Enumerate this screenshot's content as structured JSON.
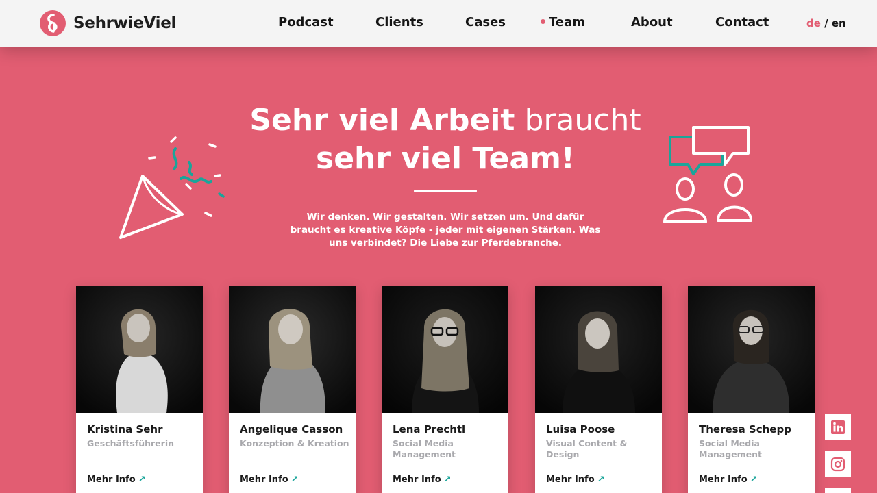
{
  "brand": {
    "name": "SehrwieViel",
    "accent": "#e25d72",
    "teal": "#1aa59a"
  },
  "nav": {
    "items": [
      {
        "label": "Podcast"
      },
      {
        "label": "Clients"
      },
      {
        "label": "Cases"
      },
      {
        "label": "Team",
        "active": true
      },
      {
        "label": "About"
      },
      {
        "label": "Contact"
      }
    ]
  },
  "lang": {
    "current": "de",
    "separator": " / ",
    "other": "en"
  },
  "hero": {
    "title_bold_1": "Sehr viel Arbeit",
    "title_light": " braucht",
    "title_bold_2": "sehr viel Team!",
    "intro": "Wir denken. Wir gestalten. Wir setzen um. Und dafür braucht es kreative Köpfe - jeder mit eigenen Stärken. Was uns verbindet? Die Liebe zur Pferdebranche."
  },
  "team": [
    {
      "name": "Kristina Sehr",
      "role": "Geschäftsführerin",
      "more": "Mehr Info"
    },
    {
      "name": "Angelique Casson",
      "role": "Konzeption & Kreation",
      "more": "Mehr Info"
    },
    {
      "name": "Lena Prechtl",
      "role": "Social Media Management",
      "more": "Mehr Info"
    },
    {
      "name": "Luisa Poose",
      "role": "Visual Content & Design",
      "more": "Mehr Info"
    },
    {
      "name": "Theresa Schepp",
      "role": "Social Media Management",
      "more": "Mehr Info"
    }
  ],
  "social": [
    {
      "icon": "linkedin-icon"
    },
    {
      "icon": "instagram-icon"
    }
  ]
}
